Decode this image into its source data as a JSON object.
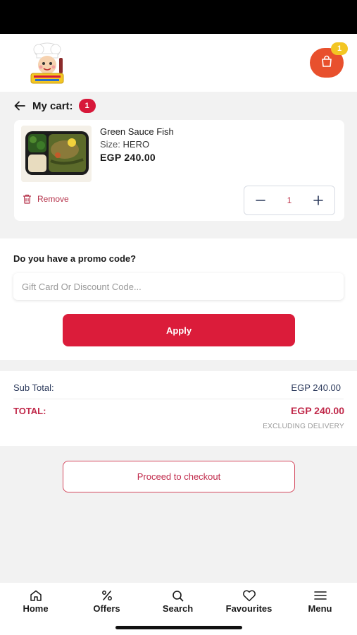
{
  "header": {
    "logo_icon": "chef-mascot-logo",
    "cart_badge": "1",
    "colors": {
      "cart_button": "#e8502d",
      "badge": "#f3c623"
    }
  },
  "cart": {
    "title": "My cart:",
    "count": "1",
    "item": {
      "name": "Green Sauce Fish",
      "size_label": "Size:",
      "size_value": "HERO",
      "price": "EGP 240.00",
      "remove_label": "Remove",
      "quantity": "1"
    }
  },
  "promo": {
    "question": "Do you have a promo code?",
    "placeholder": "Gift Card Or Discount Code...",
    "apply_label": "Apply"
  },
  "totals": {
    "sub_total_label": "Sub Total:",
    "sub_total_value": "EGP 240.00",
    "total_label": "TOTAL:",
    "total_value": "EGP 240.00",
    "note": "EXCLUDING DELIVERY"
  },
  "checkout": {
    "label": "Proceed to checkout"
  },
  "nav": {
    "items": [
      {
        "label": "Home",
        "icon": "home-icon"
      },
      {
        "label": "Offers",
        "icon": "percent-icon"
      },
      {
        "label": "Search",
        "icon": "search-icon"
      },
      {
        "label": "Favourites",
        "icon": "heart-icon"
      },
      {
        "label": "Menu",
        "icon": "menu-icon"
      }
    ]
  },
  "colors": {
    "primary": "#db1c3a",
    "total_text": "#c0294a",
    "subtotal_text": "#2c3a5c"
  }
}
